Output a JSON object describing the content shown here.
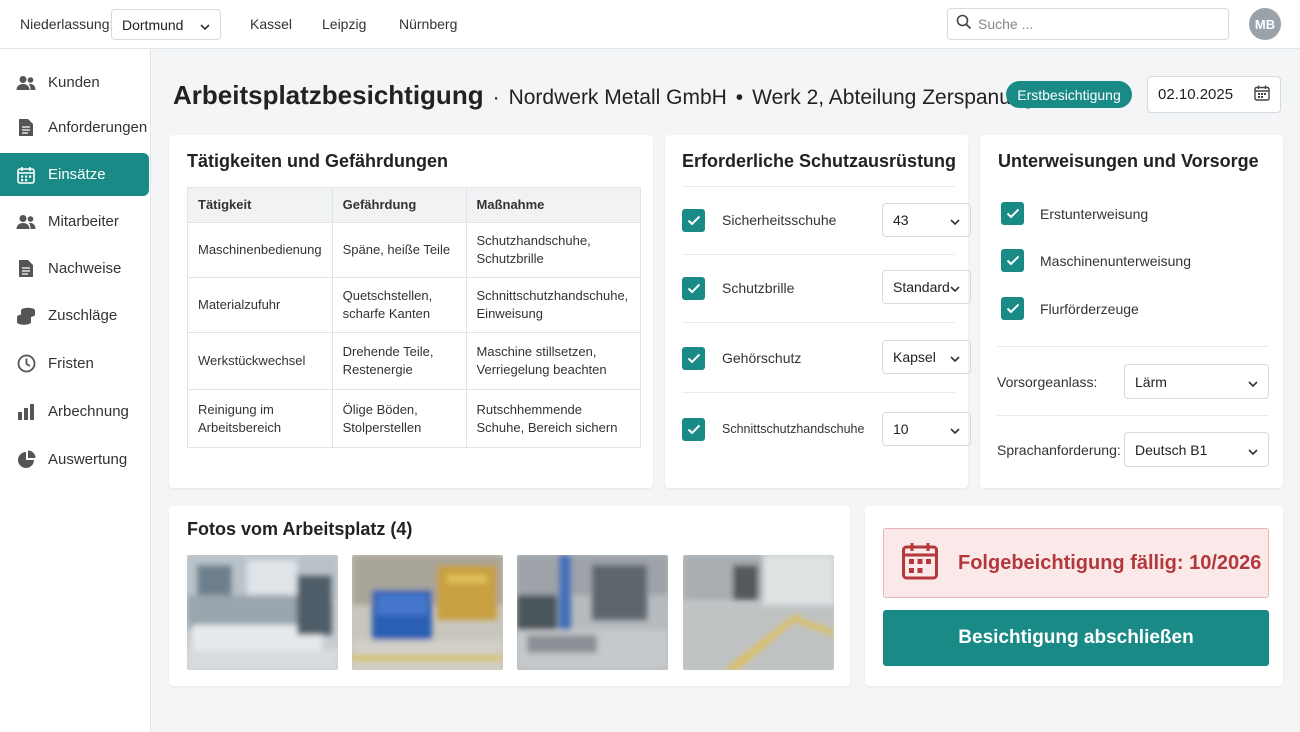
{
  "topbar": {
    "branch_label": "Niederlassung:",
    "branch_selected": "Dortmund",
    "branch_links": [
      "Kassel",
      "Leipzig",
      "Nürnberg"
    ],
    "search_placeholder": "Suche ...",
    "avatar_initials": "MB"
  },
  "sidebar": {
    "items": [
      {
        "label": "Kunden",
        "icon": "users-icon"
      },
      {
        "label": "Anforderungen",
        "icon": "document-icon"
      },
      {
        "label": "Einsätze",
        "icon": "calendar-icon",
        "active": true
      },
      {
        "label": "Mitarbeiter",
        "icon": "users-icon"
      },
      {
        "label": "Nachweise",
        "icon": "document-icon"
      },
      {
        "label": "Zuschläge",
        "icon": "coins-icon"
      },
      {
        "label": "Fristen",
        "icon": "clock-icon"
      },
      {
        "label": "Arbechnung",
        "icon": "bar-chart-icon"
      },
      {
        "label": "Auswertung",
        "icon": "pie-chart-icon"
      }
    ]
  },
  "header": {
    "title": "Arbeitsplatzbesichtigung",
    "company": "Nordwerk Metall GmbH",
    "location": "Werk 2, Abteilung Zerspanung",
    "separator": "·",
    "separator2": "•",
    "badge": "Erstbesichtigung",
    "date": "02.10.2025"
  },
  "hazards": {
    "title": "Tätigkeiten und Gefährdungen",
    "columns": [
      "Tätigkeit",
      "Gefährdung",
      "Maßnahme"
    ],
    "rows": [
      [
        "Maschinenbedienung",
        "Späne, heiße Teile",
        "Schutzhandschuhe, Schutzbrille"
      ],
      [
        "Materialzufuhr",
        "Quetschstellen, scharfe Kanten",
        "Schnittschutzhandschuhe, Einweisung"
      ],
      [
        "Werkstückwechsel",
        "Drehende Teile, Restenergie",
        "Maschine stillsetzen, Verriegelung beachten"
      ],
      [
        "Reinigung im Arbeitsbereich",
        "Ölige Böden, Stolperstellen",
        "Rutschhemmende Schuhe, Bereich sichern"
      ]
    ]
  },
  "ppe": {
    "title": "Erforderliche Schutzausrüstung",
    "items": [
      {
        "label": "Sicherheitsschuhe",
        "value": "43",
        "checked": true
      },
      {
        "label": "Schutzbrille",
        "value": "Standard",
        "checked": true
      },
      {
        "label": "Gehörschutz",
        "value": "Kapsel",
        "checked": true
      },
      {
        "label": "Schnittschutzhandschuhe",
        "value": "10",
        "checked": true
      }
    ]
  },
  "training": {
    "title": "Unterweisungen und Vorsorge",
    "items": [
      {
        "label": "Erstunterweisung",
        "checked": true
      },
      {
        "label": "Maschinenunterweisung",
        "checked": true
      },
      {
        "label": "Flurförderzeuge",
        "checked": true
      }
    ],
    "vorsorge_label": "Vorsorgeanlass:",
    "vorsorge_value": "Lärm",
    "sprache_label": "Sprachanforderung:",
    "sprache_value": "Deutsch B1"
  },
  "photos": {
    "title": "Fotos vom Arbeitsplatz (4)"
  },
  "followup": {
    "due_text": "Folgebeichtigung fällig: 10/2026",
    "finish_button": "Besichtigung abschließen"
  },
  "colors": {
    "accent": "#1a8a87",
    "alert_bg": "#fbe9e9",
    "alert_text": "#b3383c"
  }
}
